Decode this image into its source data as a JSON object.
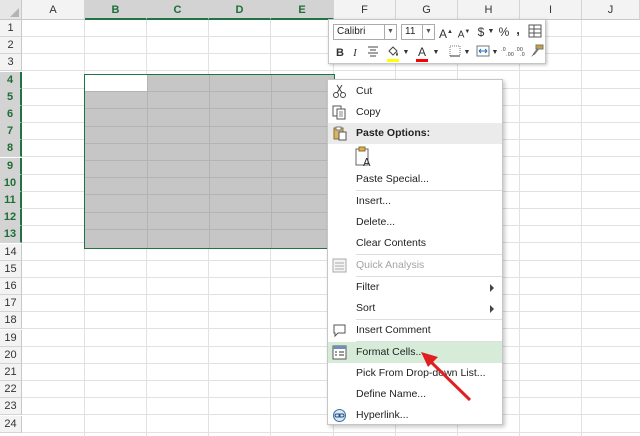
{
  "spreadsheet": {
    "columns": [
      {
        "label": "A",
        "sel": false
      },
      {
        "label": "B",
        "sel": true
      },
      {
        "label": "C",
        "sel": true
      },
      {
        "label": "D",
        "sel": true
      },
      {
        "label": "E",
        "sel": true
      },
      {
        "label": "F",
        "sel": false
      },
      {
        "label": "G",
        "sel": false
      },
      {
        "label": "H",
        "sel": false
      },
      {
        "label": "I",
        "sel": false
      },
      {
        "label": "J",
        "sel": false
      }
    ],
    "rows": [
      "1",
      "2",
      "3",
      "4",
      "5",
      "6",
      "7",
      "8",
      "9",
      "10",
      "11",
      "12",
      "13",
      "14",
      "15",
      "16",
      "17",
      "18",
      "19",
      "20",
      "21",
      "22",
      "23",
      "24"
    ],
    "selected_rows": [
      "4",
      "5",
      "6",
      "7",
      "8",
      "9",
      "10",
      "11",
      "12",
      "13"
    ]
  },
  "mini_toolbar": {
    "font_name": "Calibri",
    "font_size": "11",
    "grow_font": "A",
    "shrink_font": "A",
    "currency": "$",
    "percent": "%",
    "comma": ",",
    "bold": "B",
    "italic": "I",
    "font_color_glyph": "A",
    "highlight_color": "#ffff00",
    "font_color": "#ff0000"
  },
  "context_menu": {
    "cut": "Cut",
    "copy": "Copy",
    "paste_options": "Paste Options:",
    "paste_special": "Paste Special...",
    "insert": "Insert...",
    "delete": "Delete...",
    "clear_contents": "Clear Contents",
    "quick_analysis": "Quick Analysis",
    "filter": "Filter",
    "sort": "Sort",
    "insert_comment": "Insert Comment",
    "format_cells": "Format Cells...",
    "pick_from_list": "Pick From Drop-down List...",
    "define_name": "Define Name...",
    "hyperlink": "Hyperlink..."
  },
  "colors": {
    "accent_green": "#217346",
    "highlight_bg": "#d6ecd9",
    "annotation_arrow": "#e02020"
  }
}
